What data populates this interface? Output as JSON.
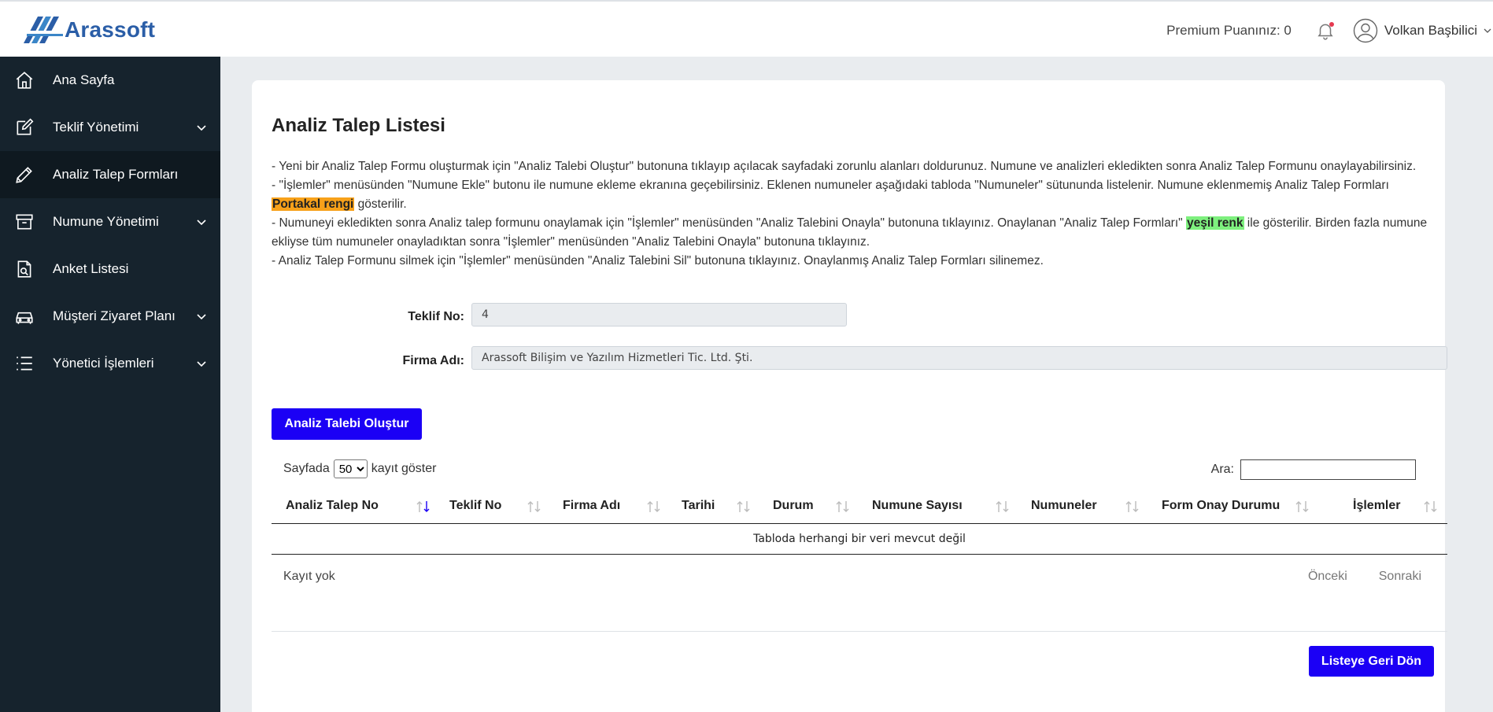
{
  "brand": {
    "name": "Arassoft"
  },
  "header": {
    "premium_text": "Premium Puanınız: 0",
    "user_name": "Volkan Başbilici",
    "bell_icon": "bell-icon",
    "avatar_icon": "user-circle-icon"
  },
  "sidebar": {
    "items": [
      {
        "label": "Ana Sayfa",
        "icon": "home-icon",
        "has_submenu": false,
        "active": false
      },
      {
        "label": "Teklif Yönetimi",
        "icon": "edit-icon",
        "has_submenu": true,
        "active": false
      },
      {
        "label": "Analiz Talep Formları",
        "icon": "pencil-icon",
        "has_submenu": false,
        "active": true
      },
      {
        "label": "Numune Yönetimi",
        "icon": "archive-icon",
        "has_submenu": true,
        "active": false
      },
      {
        "label": "Anket Listesi",
        "icon": "document-icon",
        "has_submenu": false,
        "active": false
      },
      {
        "label": "Müşteri Ziyaret Planı",
        "icon": "car-icon",
        "has_submenu": true,
        "active": false
      },
      {
        "label": "Yönetici İşlemleri",
        "icon": "list-icon",
        "has_submenu": true,
        "active": false
      }
    ]
  },
  "main": {
    "title": "Analiz Talep Listesi",
    "info": {
      "line1": "- Yeni bir Analiz Talep Formu oluşturmak için \"Analiz Talebi Oluştur\" butonuna tıklayıp açılacak sayfadaki zorunlu alanları doldurunuz. Numune ve analizleri ekledikten sonra Analiz Talep Formunu onaylayabilirsiniz.",
      "line2_a": "- \"İşlemler\" menüsünden \"Numune Ekle\" butonu ile numune ekleme ekranına geçebilirsiniz. Eklenen numuneler aşağıdaki tabloda \"Numuneler\" sütununda listelenir. Numune eklenmemiş Analiz Talep Formları ",
      "line2_hl": "Portakal rengi",
      "line2_b": " gösterilir.",
      "line3_a": "- Numuneyi ekledikten sonra Analiz talep formunu onaylamak için \"İşlemler\" menüsünden \"Analiz Talebini Onayla\" butonuna tıklayınız. Onaylanan \"Analiz Talep Formları\" ",
      "line3_hl": "yeşil renk",
      "line3_b": " ile gösterilir. Birden fazla numune ekliyse tüm numuneler onayladıktan sonra \"İşlemler\" menüsünden \"Analiz Talebini Onayla\" butonuna tıklayınız.",
      "line4": "- Analiz Talep Formunu silmek için \"İşlemler\" menüsünden \"Analiz Talebini Sil\" butonuna tıklayınız. Onaylanmış Analiz Talep Formları silinemez."
    },
    "form": {
      "teklif_label": "Teklif No:",
      "teklif_value": "4",
      "firma_label": "Firma Adı:",
      "firma_value": "Arassoft Bilişim ve Yazılım Hizmetleri Tic. Ltd. Şti."
    },
    "create_button": "Analiz Talebi Oluştur",
    "table": {
      "length_prefix": "Sayfada",
      "length_value": "50",
      "length_suffix": "kayıt göster",
      "search_label": "Ara:",
      "columns": [
        "Analiz Talep No",
        "Teklif No",
        "Firma Adı",
        "Tarihi",
        "Durum",
        "Numune Sayısı",
        "Numuneler",
        "Form Onay Durumu",
        "İşlemler"
      ],
      "empty_text": "Tabloda herhangi bir veri mevcut değil",
      "info_text": "Kayıt yok",
      "prev_label": "Önceki",
      "next_label": "Sonraki"
    },
    "back_button": "Listeye Geri Dön"
  },
  "colors": {
    "primary_button": "#1b00f5",
    "sidebar_bg": "#16232d",
    "orange_highlight": "#f7a11a",
    "green_highlight": "#7ef07e",
    "brand": "#2b5ea7"
  }
}
